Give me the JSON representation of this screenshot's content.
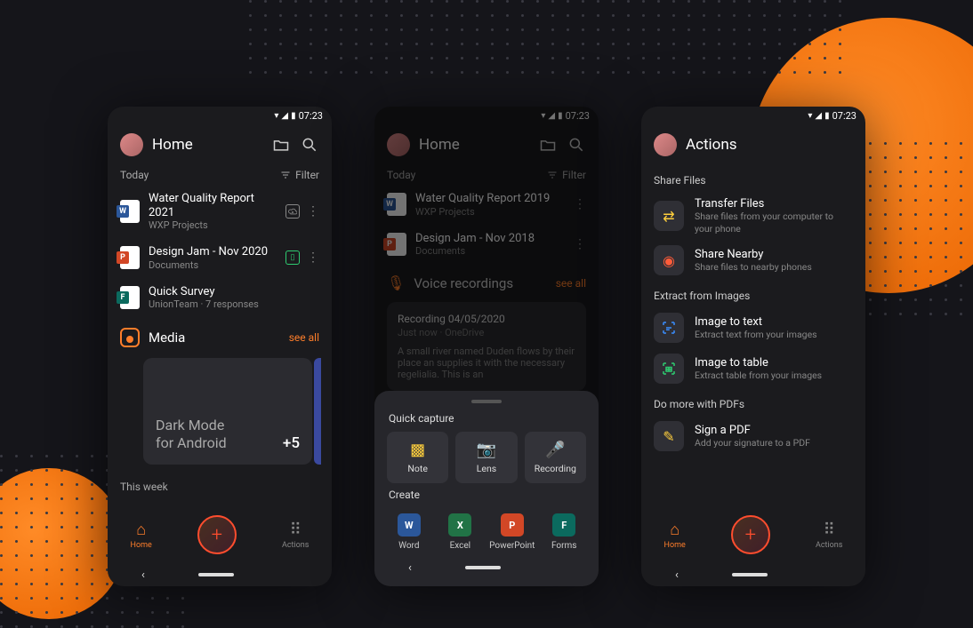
{
  "status": {
    "time": "07:23"
  },
  "screens": {
    "home": {
      "title": "Home",
      "subheader": {
        "today": "Today",
        "filter": "Filter"
      },
      "files": [
        {
          "kind": "word",
          "name": "Water Quality Report 2021",
          "sub": "WXP Projects",
          "dl": "cloud"
        },
        {
          "kind": "ppt",
          "name": "Design Jam - Nov 2020",
          "sub": "Documents",
          "dl": "green"
        },
        {
          "kind": "forms",
          "name": "Quick Survey",
          "sub": "UnionTeam · 7 responses"
        }
      ],
      "media": {
        "title": "Media",
        "see_all": "see all",
        "card_line1": "Dark Mode",
        "card_line2": "for Android",
        "more": "+5"
      },
      "this_week": "This week"
    },
    "quick": {
      "title": "Home",
      "subheader": {
        "today": "Today",
        "filter": "Filter"
      },
      "files": [
        {
          "kind": "word",
          "name": "Water Quality Report 2019",
          "sub": "WXP Projects"
        },
        {
          "kind": "ppt",
          "name": "Design Jam - Nov 2018",
          "sub": "Documents"
        }
      ],
      "voice": {
        "header": "Voice recordings",
        "see_all": "see all",
        "card_title": "Recording 04/05/2020",
        "card_sub": "Just now · OneDrive",
        "card_body": "A small river named Duden flows by their place an supplies it with the necessary regelialia. This is an"
      },
      "sheet": {
        "quick_capture": "Quick capture",
        "capture": [
          {
            "name": "Note"
          },
          {
            "name": "Lens"
          },
          {
            "name": "Recording"
          }
        ],
        "create": "Create",
        "apps": [
          {
            "kind": "word",
            "name": "Word"
          },
          {
            "kind": "excel",
            "name": "Excel"
          },
          {
            "kind": "ppt",
            "name": "PowerPoint"
          },
          {
            "kind": "forms",
            "name": "Forms"
          }
        ]
      }
    },
    "actions": {
      "title": "Actions",
      "sections": {
        "share": {
          "title": "Share Files",
          "items": [
            {
              "name": "Transfer Files",
              "sub": "Share files from your computer to your phone"
            },
            {
              "name": "Share Nearby",
              "sub": "Share files to nearby phones"
            }
          ]
        },
        "extract": {
          "title": "Extract from Images",
          "items": [
            {
              "name": "Image to text",
              "sub": "Extract text from your images"
            },
            {
              "name": "Image to table",
              "sub": "Extract table from your images"
            }
          ]
        },
        "pdf": {
          "title": "Do more with PDFs",
          "items": [
            {
              "name": "Sign a PDF",
              "sub": "Add your signature to a PDF"
            }
          ]
        }
      }
    }
  },
  "nav": {
    "home": "Home",
    "actions": "Actions"
  }
}
